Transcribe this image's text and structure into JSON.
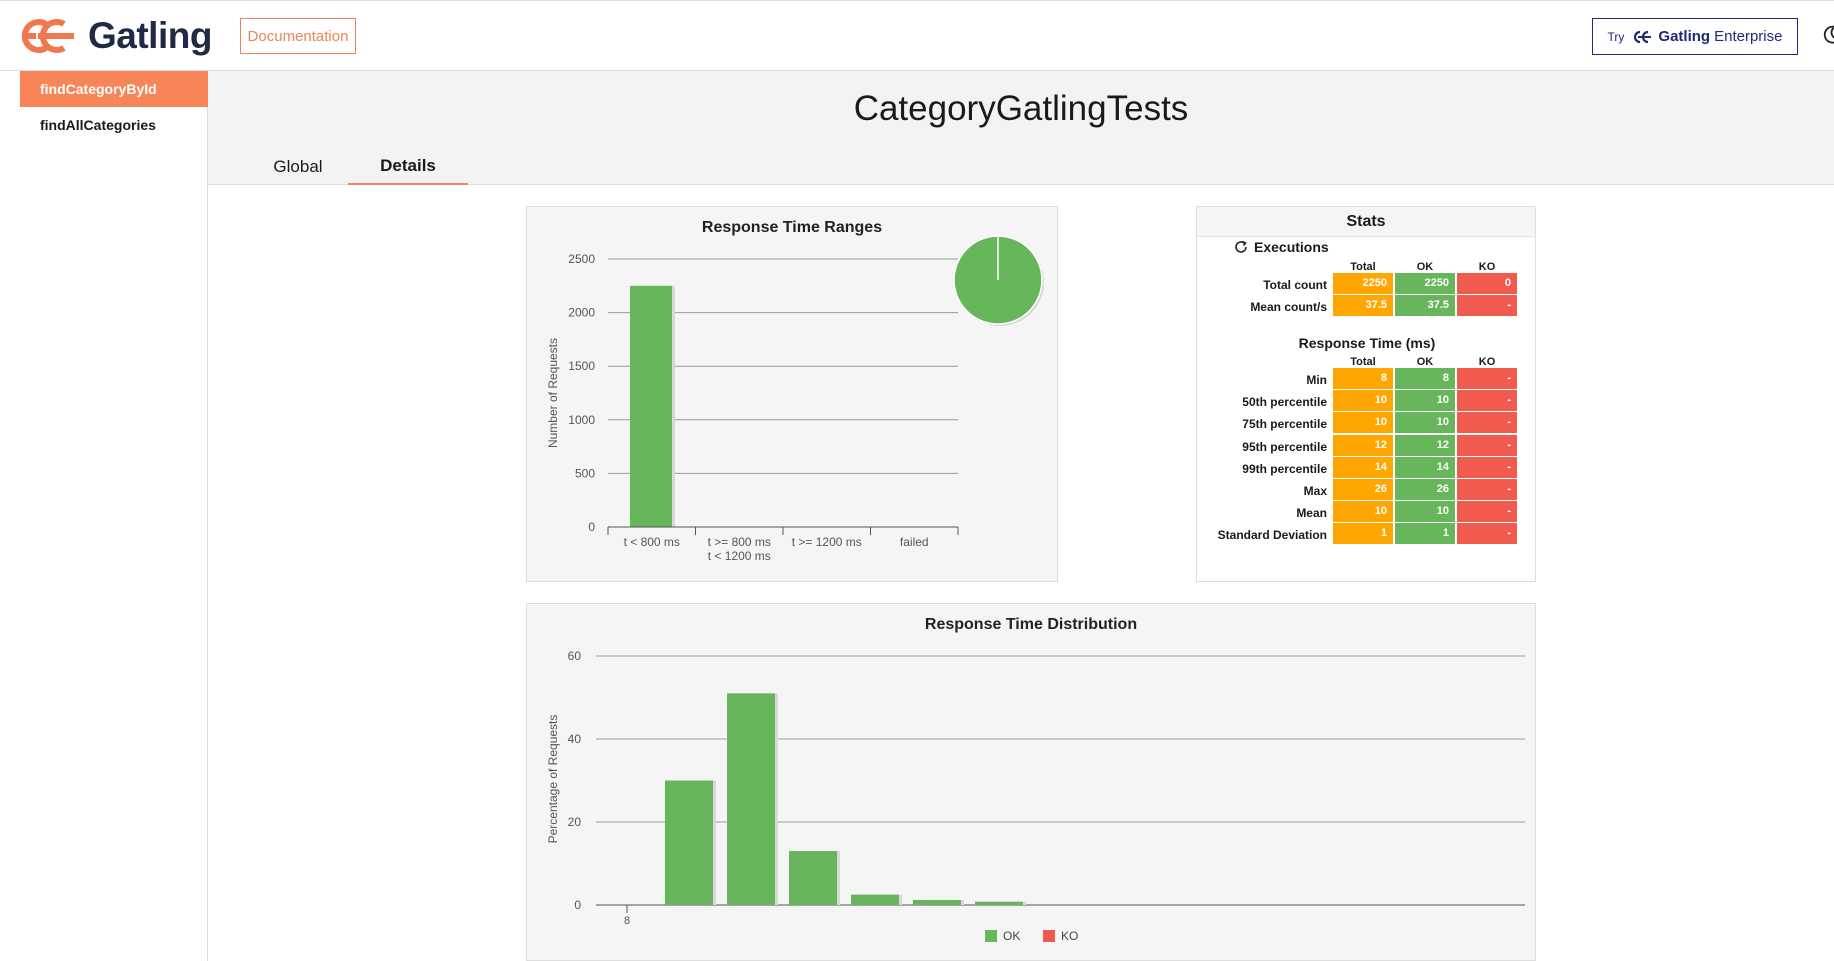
{
  "brand": {
    "name": "Gatling",
    "documentation_label": "Documentation",
    "enterprise": {
      "try": "Try",
      "brand": "Gatling",
      "word": "Enterprise"
    }
  },
  "sidebar": {
    "items": [
      {
        "label": "findCategoryById",
        "active": true
      },
      {
        "label": "findAllCategories",
        "active": false
      }
    ]
  },
  "header": {
    "title": "CategoryGatlingTests",
    "tabs": [
      {
        "label": "Global",
        "active": false
      },
      {
        "label": "Details",
        "active": true
      }
    ]
  },
  "colors": {
    "accent": "#f78557",
    "ok": "#68b65c",
    "ko": "#f15b4f",
    "total": "#ffa600"
  },
  "stats": {
    "title": "Stats",
    "executions_title": "Executions",
    "response_time_title": "Response Time (ms)",
    "columns": [
      "Total",
      "OK",
      "KO"
    ],
    "executions": [
      {
        "label": "Total count",
        "total": "2250",
        "ok": "2250",
        "ko": "0"
      },
      {
        "label": "Mean count/s",
        "total": "37.5",
        "ok": "37.5",
        "ko": "-"
      }
    ],
    "response_time": [
      {
        "label": "Min",
        "total": "8",
        "ok": "8",
        "ko": "-"
      },
      {
        "label": "50th percentile",
        "total": "10",
        "ok": "10",
        "ko": "-"
      },
      {
        "label": "75th percentile",
        "total": "10",
        "ok": "10",
        "ko": "-"
      },
      {
        "label": "95th percentile",
        "total": "12",
        "ok": "12",
        "ko": "-"
      },
      {
        "label": "99th percentile",
        "total": "14",
        "ok": "14",
        "ko": "-"
      },
      {
        "label": "Max",
        "total": "26",
        "ok": "26",
        "ko": "-"
      },
      {
        "label": "Mean",
        "total": "10",
        "ok": "10",
        "ko": "-"
      },
      {
        "label": "Standard Deviation",
        "total": "1",
        "ok": "1",
        "ko": "-"
      }
    ]
  },
  "chart_data": [
    {
      "type": "bar",
      "title": "Response Time Ranges",
      "ylabel": "Number of Requests",
      "xlabel": "",
      "categories": [
        "t < 800 ms",
        "t >= 800 ms\nt < 1200 ms",
        "t >= 1200 ms",
        "failed"
      ],
      "values": [
        2250,
        0,
        0,
        0
      ],
      "ylim": [
        0,
        2500
      ],
      "yticks": [
        0,
        500,
        1000,
        1500,
        2000,
        2500
      ],
      "grid": true,
      "pie": {
        "slices": [
          {
            "value": 100,
            "color": "#68b65c"
          }
        ]
      }
    },
    {
      "type": "bar",
      "title": "Response Time Distribution",
      "ylabel": "Percentage of Requests",
      "xlabel": "",
      "x": [
        8,
        9,
        10,
        11,
        12,
        13,
        14
      ],
      "x_tick_labels": [
        "8"
      ],
      "series": [
        {
          "name": "OK",
          "color": "#68b65c",
          "values": [
            0,
            30,
            51,
            13,
            2.5,
            1.2,
            0.8
          ]
        },
        {
          "name": "KO",
          "color": "#f15b4f",
          "values": [
            0,
            0,
            0,
            0,
            0,
            0,
            0
          ]
        }
      ],
      "ylim": [
        0,
        60
      ],
      "yticks": [
        0,
        20,
        40,
        60
      ],
      "grid": true,
      "legend": "bottom-center"
    }
  ]
}
